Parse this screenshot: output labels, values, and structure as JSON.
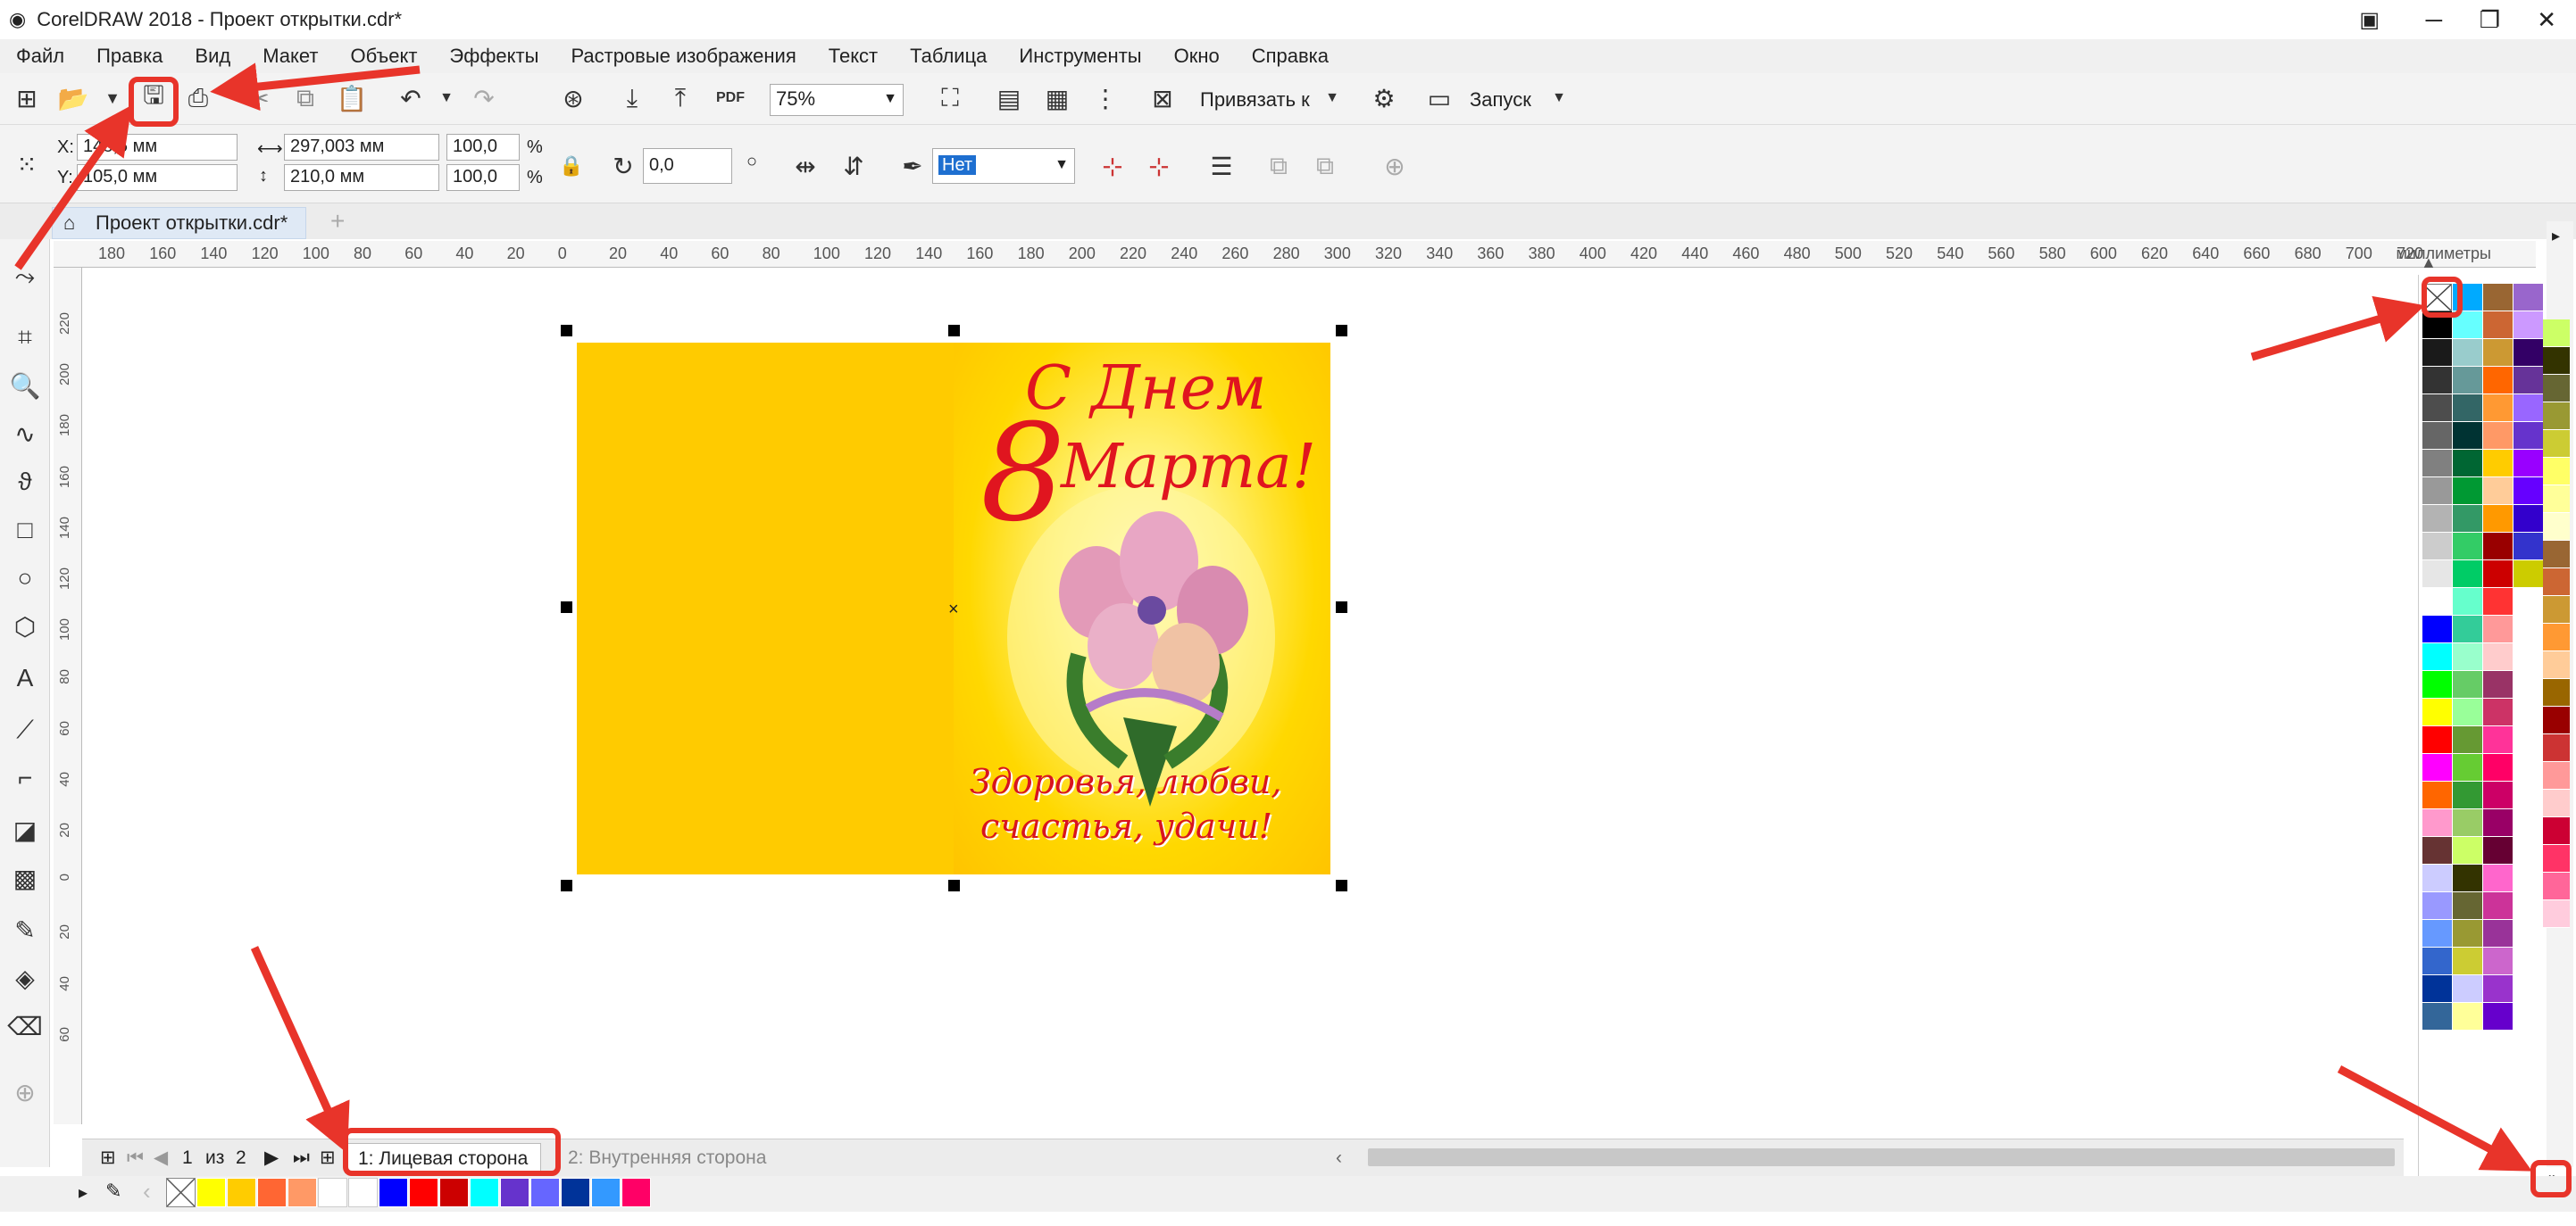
{
  "window": {
    "title": "CorelDRAW 2018 - Проект открытки.cdr*"
  },
  "menu": [
    "Файл",
    "Правка",
    "Вид",
    "Макет",
    "Объект",
    "Эффекты",
    "Растровые изображения",
    "Текст",
    "Таблица",
    "Инструменты",
    "Окно",
    "Справка"
  ],
  "toolbar": {
    "zoom": "75%",
    "snap_label": "Привязать к",
    "launch_label": "Запуск",
    "pdf_label": "PDF"
  },
  "property_bar": {
    "x_label": "X:",
    "x_value": "148,5 мм",
    "y_label": "Y:",
    "y_value": "105,0 мм",
    "width_value": "297,003 мм",
    "height_value": "210,0 мм",
    "scale_x": "100,0",
    "scale_y": "100,0",
    "percent": "%",
    "rotation": "0,0",
    "outline_value": "Нет"
  },
  "document_tab": {
    "label": "Проект открытки.cdr*"
  },
  "ruler": {
    "units": "миллиметры",
    "h_ticks": [
      "180",
      "160",
      "140",
      "120",
      "100",
      "80",
      "60",
      "40",
      "20",
      "0",
      "20",
      "40",
      "60",
      "80",
      "100",
      "120",
      "140",
      "160",
      "180",
      "200",
      "220",
      "240",
      "260",
      "280",
      "300",
      "320",
      "340",
      "360",
      "380",
      "400",
      "420",
      "440",
      "460",
      "480",
      "500",
      "520",
      "540",
      "560",
      "580",
      "600",
      "620",
      "640",
      "660",
      "680",
      "700",
      "720"
    ],
    "v_ticks": [
      "220",
      "200",
      "180",
      "160",
      "140",
      "120",
      "100",
      "80",
      "60",
      "40",
      "20",
      "0",
      "20",
      "40",
      "60"
    ]
  },
  "card": {
    "greeting_line1": "С Днем",
    "greeting_number": "8",
    "greeting_line2": "Марта!",
    "wish_line1": "Здоровья, любви,",
    "wish_line2": "счастья, удачи!"
  },
  "pages": {
    "current": "1",
    "of_label": "из",
    "total": "2",
    "tab1": "1: Лицевая сторона",
    "tab2": "2: Внутренняя сторона"
  },
  "colors": {
    "annotation": "#e8342a",
    "card_yellow": "#ffcb00",
    "greeting_red": "#e0151f"
  },
  "palette_columns": [
    [
      "#ffffff",
      "#000000",
      "#1a1a1a",
      "#333333",
      "#4d4d4d",
      "#666666",
      "#808080",
      "#999999",
      "#b3b3b3",
      "#cccccc",
      "#e6e6e6",
      "#ffffff",
      "#0000ff",
      "#00ffff",
      "#00ff00",
      "#ffff00",
      "#ff0000",
      "#ff00ff",
      "#ff6600",
      "#ff99cc",
      "#663333",
      "#ccccff",
      "#9999ff",
      "#6699ff",
      "#3366cc",
      "#003399",
      "#336699"
    ],
    [
      "#00aaff",
      "#66ffff",
      "#99cccc",
      "#669999",
      "#336666",
      "#003333",
      "#006633",
      "#009933",
      "#339966",
      "#33cc66",
      "#00cc66",
      "#66ffcc",
      "#33cc99",
      "#99ffcc",
      "#66cc66",
      "#99ff99",
      "#669933",
      "#66cc33",
      "#339933",
      "#99cc66",
      "#ccff66",
      "#333300",
      "#666633",
      "#999933",
      "#cccc33",
      "#ccccff",
      "#ffff99"
    ],
    [
      "#996633",
      "#cc6633",
      "#cc9933",
      "#ff6600",
      "#ff9933",
      "#ff9966",
      "#ffcc00",
      "#ffcc99",
      "#ff9900",
      "#990000",
      "#cc0000",
      "#ff3333",
      "#ff9999",
      "#ffcccc",
      "#993366",
      "#cc3366",
      "#ff3399",
      "#ff0066",
      "#cc0066",
      "#990066",
      "#660033",
      "#ff66cc",
      "#cc3399",
      "#993399",
      "#cc66cc",
      "#9933cc",
      "#6600cc"
    ],
    [
      "#9966cc",
      "#cc99ff",
      "#330066",
      "#663399",
      "#9966ff",
      "#6633cc",
      "#9900ff",
      "#6600ff",
      "#3300cc",
      "#3333cc",
      "#cccc00",
      "#ffffff"
    ]
  ],
  "palette_right": [
    "#ccff66",
    "#333300",
    "#666633",
    "#999933",
    "#cccc33",
    "#ffff66",
    "#ffff99",
    "#ffffcc",
    "#996633",
    "#cc6633",
    "#cc9933",
    "#ff9933",
    "#ffcc99",
    "#996600",
    "#990000",
    "#cc3333",
    "#ff9999",
    "#ffcccc",
    "#cc0033",
    "#ff3366",
    "#ff6699",
    "#ffccdd"
  ],
  "bottom_palette": [
    "#ffff00",
    "#ffcc00",
    "#ff6633",
    "#ff9966",
    "#ffffff",
    "#ffffff",
    "#0000ff",
    "#ff0000",
    "#cc0000",
    "#00ffff",
    "#6633cc",
    "#6666ff",
    "#003399",
    "#3399ff",
    "#ff0066"
  ]
}
